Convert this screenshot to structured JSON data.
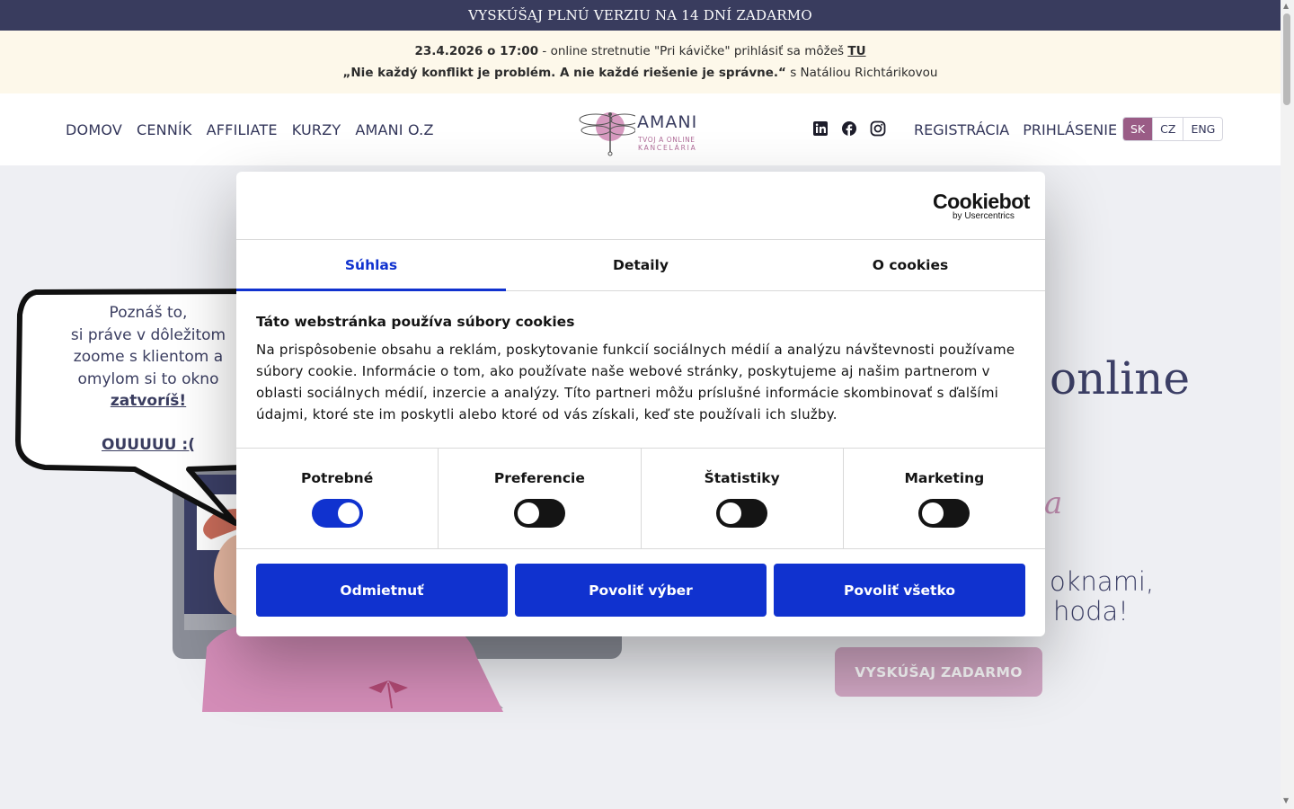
{
  "topbar": {
    "text": "VYSKÚŠAJ PLNÚ VERZIU NA 14 DNÍ ZADARMO"
  },
  "announcement": {
    "date": "23.4.2026 o 17:00",
    "line1_text": " - online stretnutie \"Pri kávičke\" prihlásiť sa môžeš ",
    "link": "TU",
    "quote": "„Nie každý konflikt je problém. A nie každé riešenie je správne.“",
    "speaker": " s Natáliou Richtárikovou"
  },
  "nav": {
    "items": [
      "DOMOV",
      "CENNÍK",
      "AFFILIATE",
      "KURZY",
      "AMANI O.Z"
    ],
    "register": "REGISTRÁCIA",
    "login": "PRIHLÁSENIE",
    "languages": [
      "SK",
      "CZ",
      "ENG"
    ],
    "active_language": "SK"
  },
  "logo": {
    "title": "AMANI",
    "subtitle1": "TVOJ A ONLINE",
    "subtitle2": "KANCELÁRIA"
  },
  "social": [
    "linkedin-icon",
    "facebook-icon",
    "instagram-icon"
  ],
  "hero": {
    "title_fragment": "online",
    "script_fragment": "a",
    "sub_line1": "oknami,",
    "sub_line2": "hoda!",
    "cta": "VYSKÚŠAJ ZADARMO"
  },
  "bubble": {
    "line1": "Poznáš to,",
    "line2": "si práve v dôležitom",
    "line3": "zoome s klientom a",
    "line4": "omylom si to okno",
    "emph": "zatvoríš!",
    "exclaim": "OUUUUU :("
  },
  "cookie": {
    "brand": "Cookiebot",
    "brand_sub": "by Usercentrics",
    "tabs": [
      "Súhlas",
      "Detaily",
      "O cookies"
    ],
    "active_tab": "Súhlas",
    "heading": "Táto webstránka používa súbory cookies",
    "body": "Na prispôsobenie obsahu a reklám, poskytovanie funkcií sociálnych médií a analýzu návštevnosti používame súbory cookie. Informácie o tom, ako používate naše webové stránky, poskytujeme aj našim partnerom v oblasti sociálnych médií, inzercie a analýzy. Títo partneri môžu príslušné informácie skombinovať s ďalšími údajmi, ktoré ste im poskytli alebo ktoré od vás získali, keď ste používali ich služby.",
    "categories": [
      {
        "label": "Potrebné",
        "enabled": true
      },
      {
        "label": "Preferencie",
        "enabled": false
      },
      {
        "label": "Štatistiky",
        "enabled": false
      },
      {
        "label": "Marketing",
        "enabled": false
      }
    ],
    "buttons": [
      "Odmietnuť",
      "Povoliť výber",
      "Povoliť všetko"
    ]
  },
  "colors": {
    "topbar": "#393c5e",
    "accent": "#9a5c86",
    "cookie_blue": "#1032cf",
    "announce_bg": "#fdf8ea"
  }
}
